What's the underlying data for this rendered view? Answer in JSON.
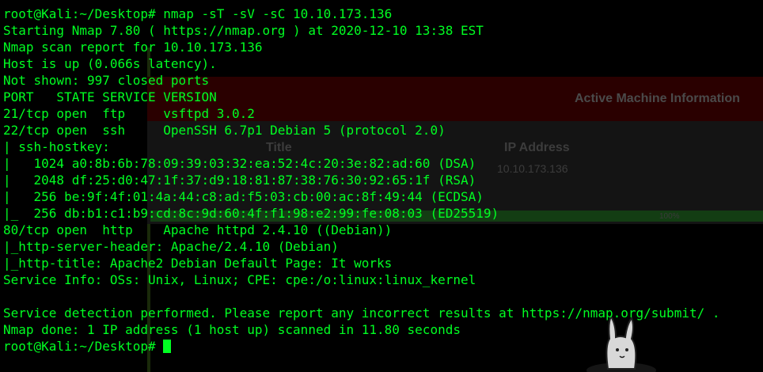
{
  "background_window": {
    "banner_title": "Active Machine Information",
    "column_title": "Title",
    "column_ip": "IP Address",
    "ip_value": "10.10.173.136",
    "progress_label": "100%",
    "progress_fraction": 1.0
  },
  "terminal": {
    "text_color": "#00ff22",
    "lines": [
      "root@Kali:~/Desktop# nmap -sT -sV -sC 10.10.173.136",
      "Starting Nmap 7.80 ( https://nmap.org ) at 2020-12-10 13:38 EST",
      "Nmap scan report for 10.10.173.136",
      "Host is up (0.066s latency).",
      "Not shown: 997 closed ports",
      "PORT   STATE SERVICE VERSION",
      "21/tcp open  ftp     vsftpd 3.0.2",
      "22/tcp open  ssh     OpenSSH 6.7p1 Debian 5 (protocol 2.0)",
      "| ssh-hostkey: ",
      "|   1024 a0:8b:6b:78:09:39:03:32:ea:52:4c:20:3e:82:ad:60 (DSA)",
      "|   2048 df:25:d0:47:1f:37:d9:18:81:87:38:76:30:92:65:1f (RSA)",
      "|   256 be:9f:4f:01:4a:44:c8:ad:f5:03:cb:00:ac:8f:49:44 (ECDSA)",
      "|_  256 db:b1:c1:b9:cd:8c:9d:60:4f:f1:98:e2:99:fe:08:03 (ED25519)",
      "80/tcp open  http    Apache httpd 2.4.10 ((Debian))",
      "|_http-server-header: Apache/2.4.10 (Debian)",
      "|_http-title: Apache2 Debian Default Page: It works",
      "Service Info: OSs: Unix, Linux; CPE: cpe:/o:linux:linux_kernel",
      "",
      "Service detection performed. Please report any incorrect results at https://nmap.org/submit/ .",
      "Nmap done: 1 IP address (1 host up) scanned in 11.80 seconds"
    ],
    "prompt": "root@Kali:~/Desktop# "
  }
}
